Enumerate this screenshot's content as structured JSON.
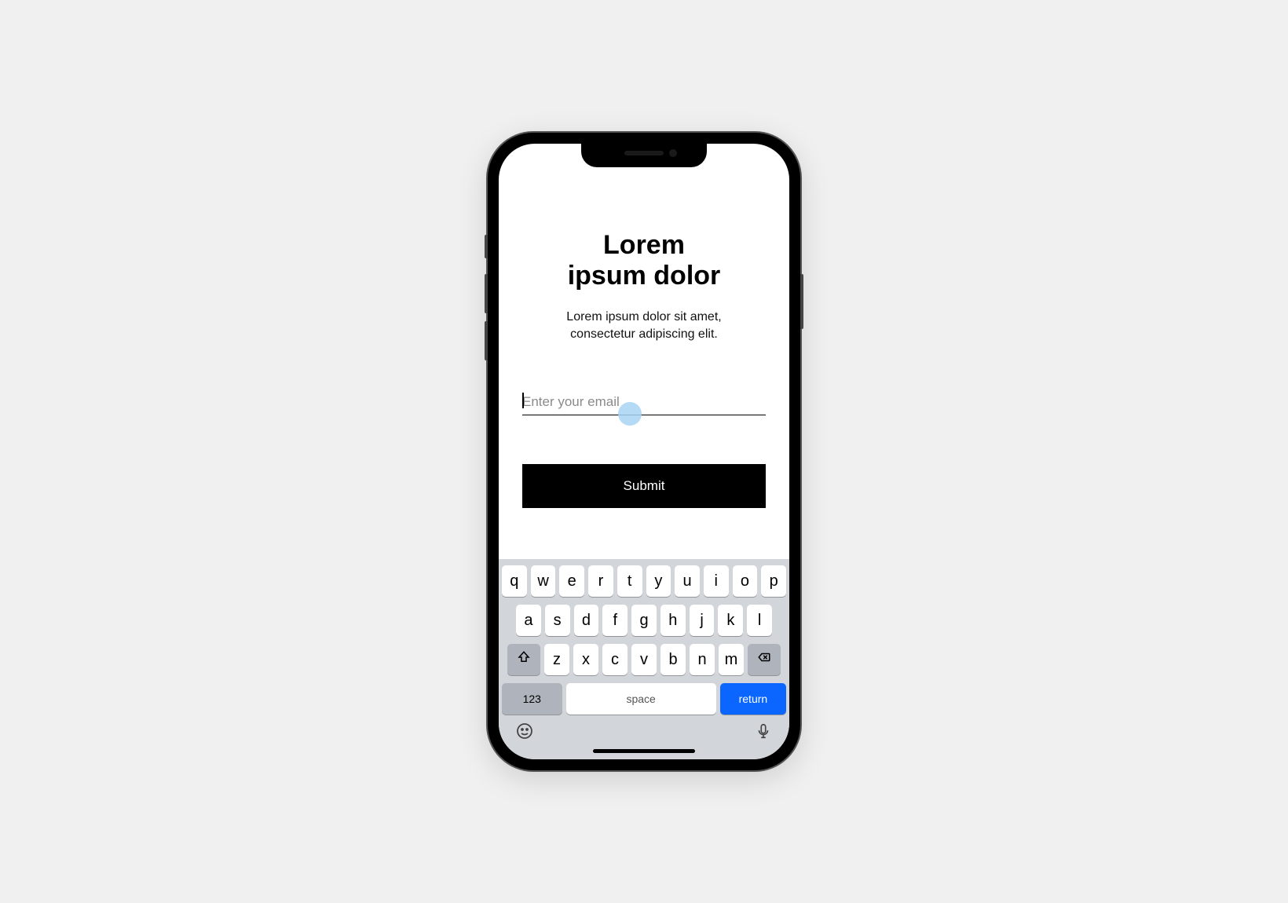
{
  "page": {
    "title": "Lorem\nipsum dolor",
    "subtitle": "Lorem ipsum dolor sit amet,\nconsectetur adipiscing elit.",
    "email_placeholder": "Enter your email",
    "submit_label": "Submit"
  },
  "keyboard": {
    "row1": [
      "q",
      "w",
      "e",
      "r",
      "t",
      "y",
      "u",
      "i",
      "o",
      "p"
    ],
    "row2": [
      "a",
      "s",
      "d",
      "f",
      "g",
      "h",
      "j",
      "k",
      "l"
    ],
    "row3": [
      "z",
      "x",
      "c",
      "v",
      "b",
      "n",
      "m"
    ],
    "numeric_label": "123",
    "space_label": "space",
    "return_label": "return"
  }
}
